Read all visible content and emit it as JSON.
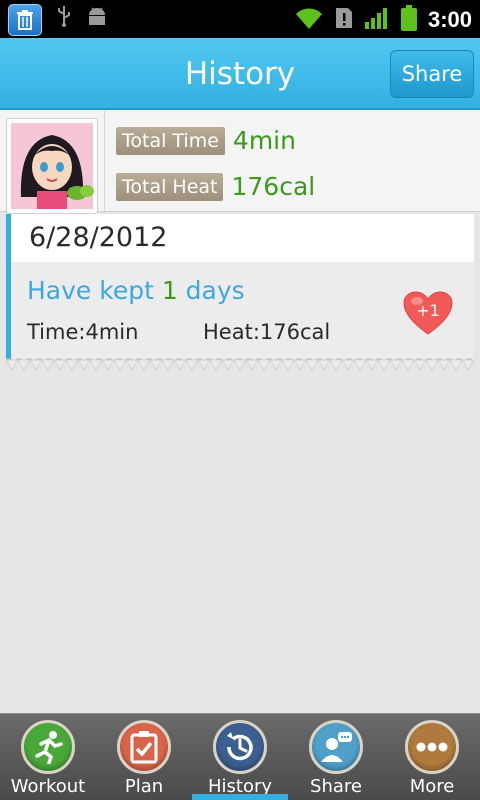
{
  "status_bar": {
    "time": "3:00",
    "icons": [
      "trash-icon",
      "usb-icon",
      "android-icon",
      "wifi-icon",
      "alert-icon",
      "signal-icon",
      "battery-icon"
    ]
  },
  "header": {
    "title": "History",
    "share_label": "Share"
  },
  "summary": {
    "total_time_label": "Total Time",
    "total_time_value": "4min",
    "total_heat_label": "Total Heat",
    "total_heat_value": "176cal"
  },
  "record": {
    "date": "6/28/2012",
    "kept_prefix": "Have kept ",
    "kept_count": "1",
    "kept_suffix": " days",
    "time_text": "Time:4min",
    "heat_text": "Heat:176cal",
    "like_badge": "+1"
  },
  "nav": {
    "items": [
      {
        "label": "Workout",
        "icon": "runner-icon",
        "color": "#4aa83a"
      },
      {
        "label": "Plan",
        "icon": "clipboard-check-icon",
        "color": "#d9644a"
      },
      {
        "label": "History",
        "icon": "history-clock-icon",
        "color": "#3b5f8f"
      },
      {
        "label": "Share",
        "icon": "share-user-icon",
        "color": "#4f9fc8"
      },
      {
        "label": "More",
        "icon": "more-dots-icon",
        "color": "#b07a3c"
      }
    ],
    "active": "History"
  },
  "colors": {
    "accent": "#32b0e2",
    "value_green": "#3a9a1e",
    "kept_blue": "#3da8df"
  }
}
